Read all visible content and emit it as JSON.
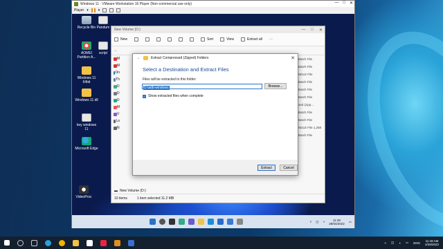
{
  "vmware": {
    "title": "Windows 11 - VMware Workstation 16 Player (Non-commercial use only)",
    "player_menu": "Player",
    "window_buttons": [
      "—",
      "□",
      "✕"
    ]
  },
  "guest_desktop": {
    "icons": [
      {
        "label": "Recycle Bin",
        "glyph": "recycle-bin"
      },
      {
        "label": "Pandum",
        "glyph": "file"
      },
      {
        "label": "AOMEI Partition A...",
        "glyph": "aomei"
      },
      {
        "label": "script",
        "glyph": "file"
      },
      {
        "label": "Windows 11 64bit",
        "glyph": "folder"
      },
      {
        "label": "Windows 11 dll",
        "glyph": "folder"
      },
      {
        "label": "key windows 11",
        "glyph": "file"
      },
      {
        "label": "Microsoft Edge",
        "glyph": "edge"
      },
      {
        "label": "VideoProc",
        "glyph": "video"
      }
    ]
  },
  "explorer": {
    "title": "New Volume (D:)",
    "toolbar": {
      "new": "New",
      "sort": "Sort",
      "view": "View",
      "extract_all": "Extract all"
    },
    "side_items": [
      "M",
      "M",
      "On",
      "Th",
      "D",
      "D",
      "D",
      "M",
      "V",
      "Lo",
      "N"
    ],
    "right_list": [
      "Batch File",
      "Batch File",
      "NDLE File",
      "Batch File",
      "Batch File",
      "Batch File",
      "sed (zipp...",
      "Batch File",
      "Batch File",
      "NDLE File 1,258",
      "Batch File"
    ],
    "bottom_location": "New Volume (D:)",
    "status": {
      "items": "10 items",
      "selected": "1 item selected 11.2 MB"
    }
  },
  "dialog": {
    "title": "Extract Compressed (Zipped) Folders",
    "heading": "Select a Destination and Extract Files",
    "label": "Files will be extracted to this folder:",
    "path": "D:\\adb-windows",
    "browse": "Browse...",
    "checkbox_label": "Show extracted files when complete",
    "checkbox_checked": true,
    "extract": "Extract",
    "cancel": "Cancel"
  },
  "guest_taskbar": {
    "time": "11:49",
    "date": "28/04/2022",
    "lang": "ENG"
  },
  "host_taskbar": {
    "time": "11:49 AM",
    "date": "4/28/2022",
    "lang": "ENG"
  },
  "colors": {
    "accent": "#2a72c8",
    "folder": "#f3c244",
    "heading": "#1a4b8f"
  }
}
